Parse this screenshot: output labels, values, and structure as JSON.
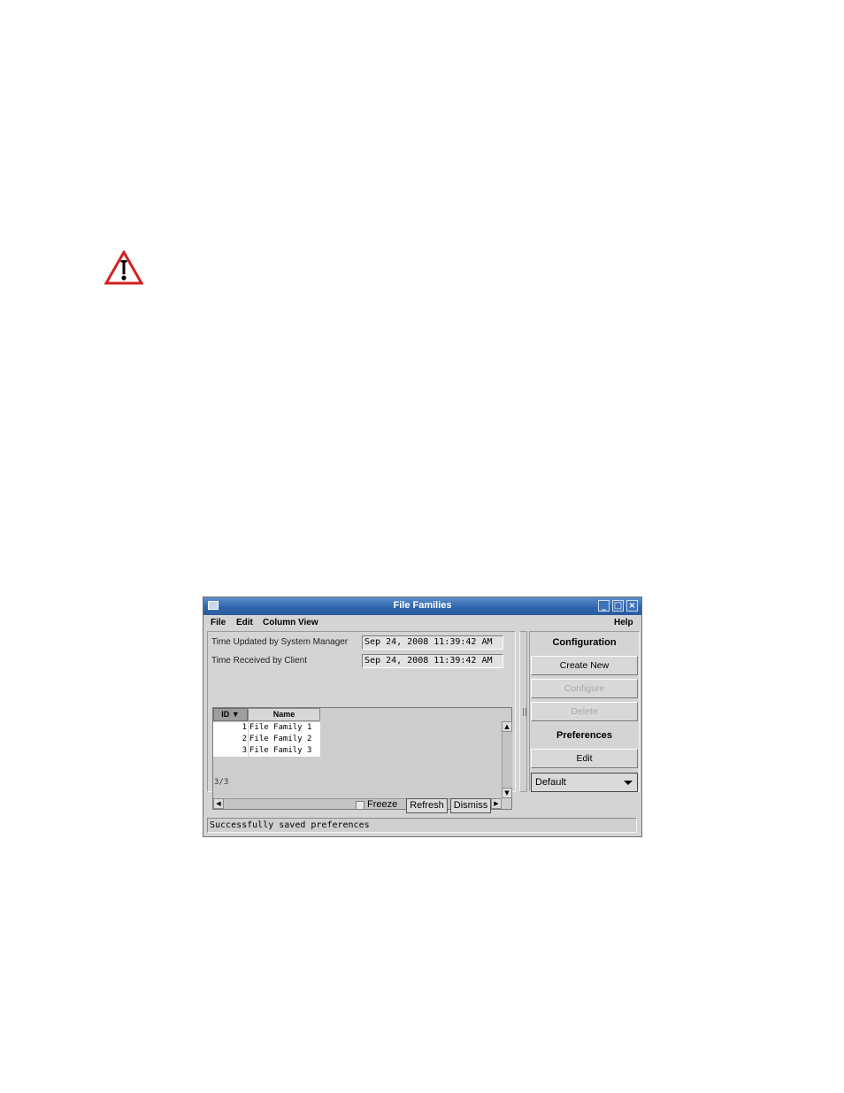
{
  "window": {
    "title": "File Families",
    "controls": {
      "minimize": "_",
      "maximize": "□",
      "close": "×"
    }
  },
  "menubar": {
    "file": "File",
    "edit": "Edit",
    "column_view": "Column View",
    "help": "Help"
  },
  "info": {
    "time_updated_label": "Time Updated by System Manager",
    "time_updated_value": "Sep 24, 2008 11:39:42 AM",
    "time_received_label": "Time Received by Client",
    "time_received_value": "Sep 24, 2008 11:39:42 AM"
  },
  "table": {
    "columns": [
      "ID ▼",
      "Name"
    ],
    "rows": [
      {
        "id": "1",
        "name": "File Family 1"
      },
      {
        "id": "2",
        "name": "File Family 2"
      },
      {
        "id": "3",
        "name": "File Family 3"
      }
    ],
    "count": "3/3"
  },
  "right_panel": {
    "configuration_heading": "Configuration",
    "create_new": "Create New",
    "configure": "Configure",
    "delete": "Delete",
    "preferences_heading": "Preferences",
    "edit": "Edit",
    "preference_selected": "Default"
  },
  "bottom": {
    "freeze_label": "Freeze",
    "refresh": "Refresh",
    "dismiss": "Dismiss"
  },
  "status": "Successfully saved preferences",
  "icons": [
    "warning-icon",
    "window-menu-icon",
    "minimize-icon",
    "maximize-icon",
    "close-icon",
    "sort-desc-icon",
    "scroll-up-icon",
    "scroll-down-icon",
    "scroll-left-icon",
    "scroll-right-icon",
    "dropdown-arrow-icon"
  ],
  "colors": {
    "titlebar": "#2f66ad",
    "warning_red": "#d42020"
  }
}
